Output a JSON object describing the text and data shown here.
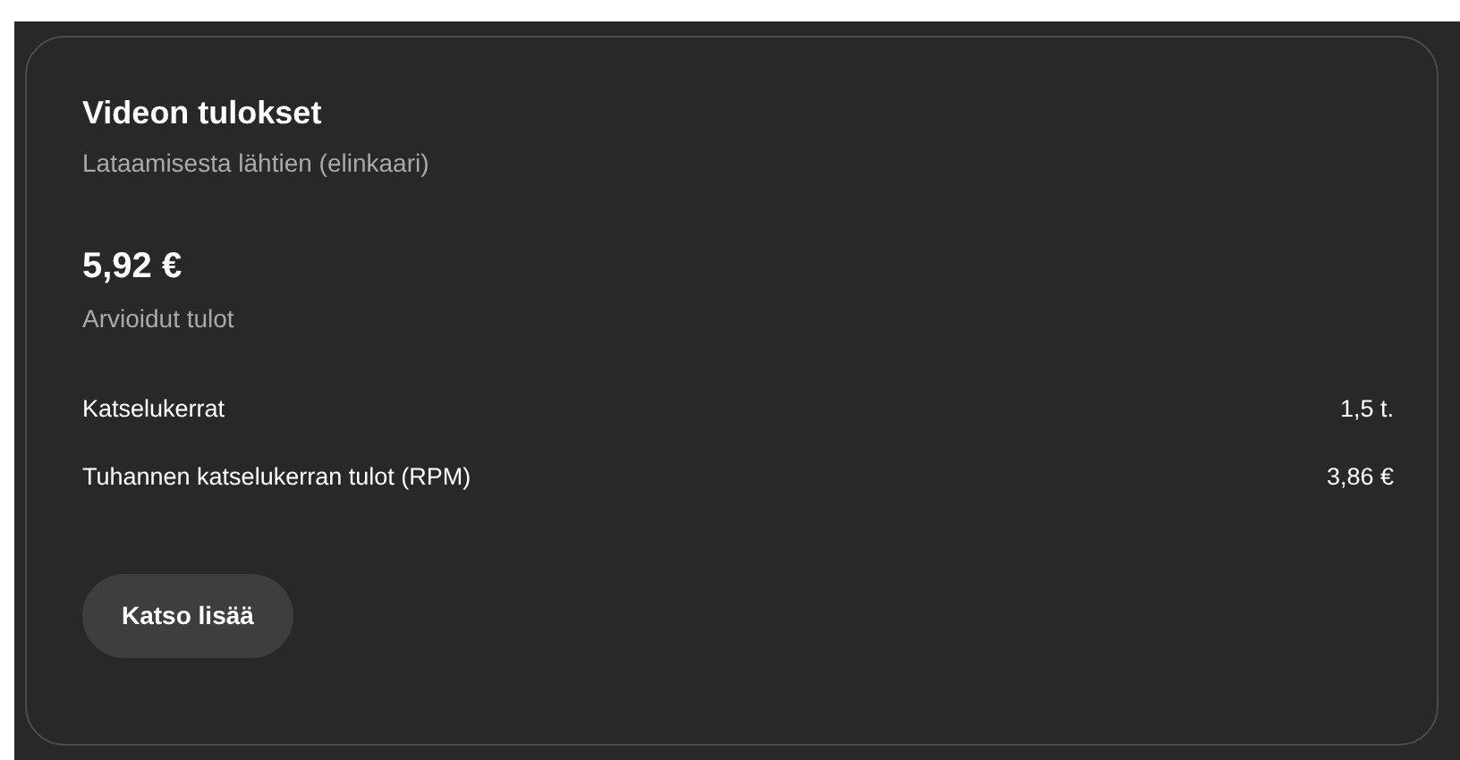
{
  "card": {
    "title": "Videon tulokset",
    "subtitle": "Lataamisesta lähtien (elinkaari)",
    "amount": "5,92 €",
    "amount_label": "Arvioidut tulot",
    "metrics": [
      {
        "label": "Katselukerrat",
        "value": "1,5 t."
      },
      {
        "label": "Tuhannen katselukerran tulot (RPM)",
        "value": "3,86 €"
      }
    ],
    "button": "Katso lisää"
  }
}
